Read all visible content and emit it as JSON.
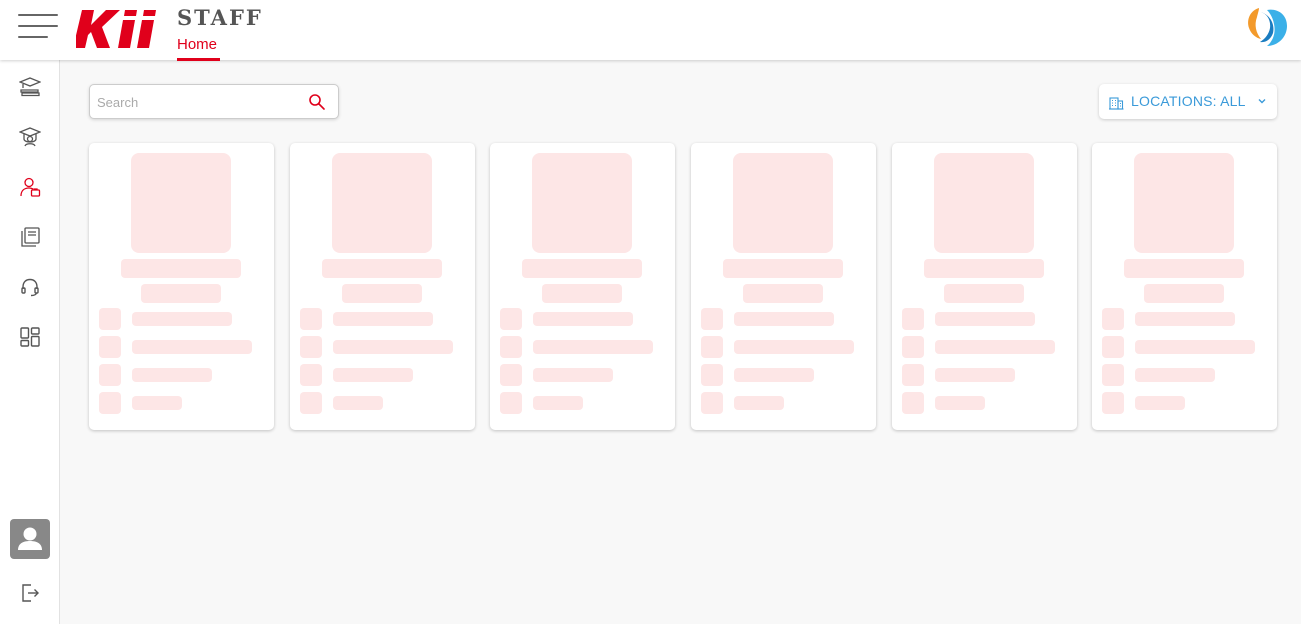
{
  "header": {
    "brand": "STAFF",
    "active_tab": "Home",
    "logo_icon": "kii-logo",
    "brand_mark_icon": "company-mark-icon",
    "accent_color": "#e0001b"
  },
  "sidebar": {
    "items": [
      {
        "name": "courses",
        "icon": "graduation-books-icon"
      },
      {
        "name": "students",
        "icon": "student-cap-icon"
      },
      {
        "name": "staff",
        "icon": "staff-user-icon",
        "active": true
      },
      {
        "name": "library",
        "icon": "library-books-icon"
      },
      {
        "name": "support",
        "icon": "headset-icon"
      },
      {
        "name": "dashboard",
        "icon": "dashboard-grid-icon"
      }
    ],
    "footer": [
      {
        "name": "profile",
        "icon": "user-avatar-icon"
      },
      {
        "name": "logout",
        "icon": "logout-icon"
      }
    ]
  },
  "search": {
    "placeholder": "Search",
    "value": ""
  },
  "locations": {
    "label": "LOCATIONS: ALL",
    "color": "#3a9ad9"
  },
  "skeleton": {
    "card_count": 6,
    "color": "#fde6e6"
  }
}
